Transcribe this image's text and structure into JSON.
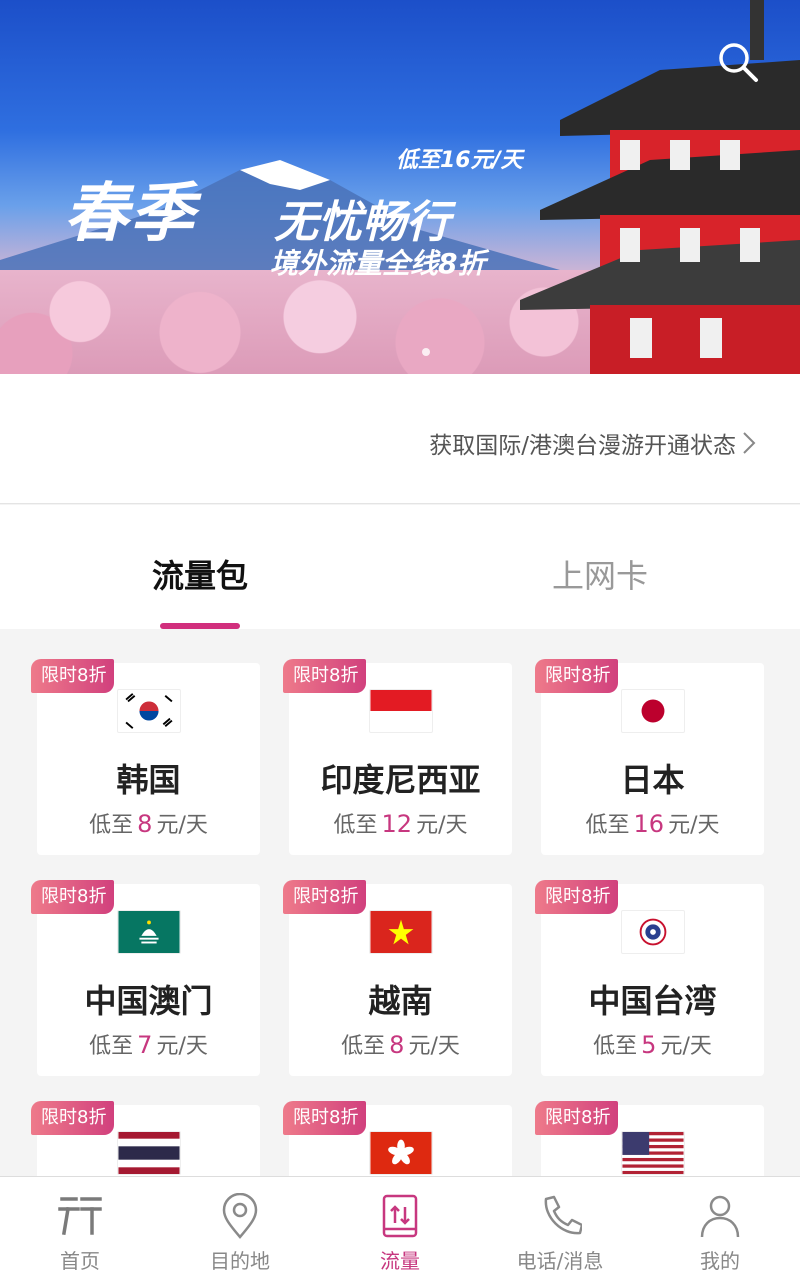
{
  "banner": {
    "price_tag": "低至16元/天",
    "headline_big": "春季",
    "headline_mid": "无忧畅行",
    "headline_sub": "境外流量全线8折"
  },
  "status": {
    "link_label": "获取国际/港澳台漫游开通状态"
  },
  "tabs": [
    {
      "label": "流量包",
      "active": true
    },
    {
      "label": "上网卡",
      "active": false
    }
  ],
  "cards": [
    {
      "badge": "限时8折",
      "name": "韩国",
      "price_prefix": "低至",
      "price": "8",
      "price_suffix": "元/天",
      "flag": "korea-flag-icon"
    },
    {
      "badge": "限时8折",
      "name": "印度尼西亚",
      "price_prefix": "低至",
      "price": "12",
      "price_suffix": "元/天",
      "flag": "indonesia-flag-icon"
    },
    {
      "badge": "限时8折",
      "name": "日本",
      "price_prefix": "低至",
      "price": "16",
      "price_suffix": "元/天",
      "flag": "japan-flag-icon"
    },
    {
      "badge": "限时8折",
      "name": "中国澳门",
      "price_prefix": "低至",
      "price": "7",
      "price_suffix": "元/天",
      "flag": "macau-flag-icon"
    },
    {
      "badge": "限时8折",
      "name": "越南",
      "price_prefix": "低至",
      "price": "8",
      "price_suffix": "元/天",
      "flag": "vietnam-flag-icon"
    },
    {
      "badge": "限时8折",
      "name": "中国台湾",
      "price_prefix": "低至",
      "price": "5",
      "price_suffix": "元/天",
      "flag": "taiwan-flag-icon"
    },
    {
      "badge": "限时8折",
      "flag": "thailand-flag-icon"
    },
    {
      "badge": "限时8折",
      "flag": "hongkong-flag-icon"
    },
    {
      "badge": "限时8折",
      "flag": "usa-flag-icon"
    }
  ],
  "nav": [
    {
      "label": "首页",
      "icon": "home-icon"
    },
    {
      "label": "目的地",
      "icon": "location-pin-icon"
    },
    {
      "label": "流量",
      "icon": "data-traffic-icon",
      "active": true
    },
    {
      "label": "电话/消息",
      "icon": "phone-icon"
    },
    {
      "label": "我的",
      "icon": "user-icon"
    }
  ],
  "colors": {
    "accent": "#c7377f",
    "badge_start": "#ee7a8a",
    "badge_end": "#d1407d"
  }
}
